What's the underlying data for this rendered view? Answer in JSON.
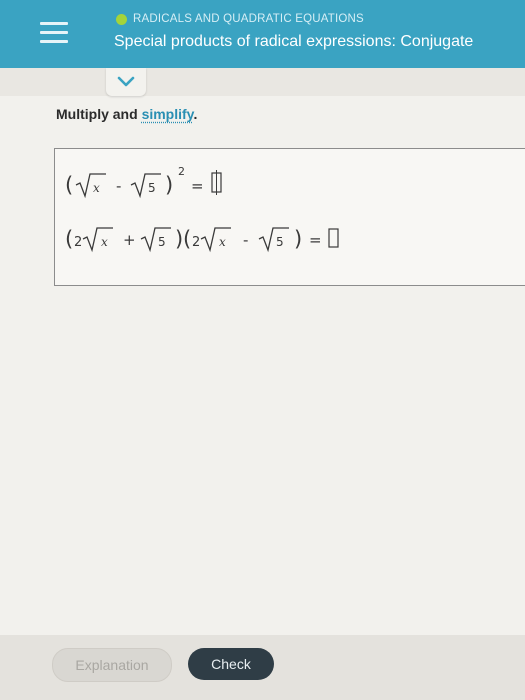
{
  "header": {
    "topic": "RADICALS AND QUADRATIC EQUATIONS",
    "title": "Special products of radical expressions: Conjugate"
  },
  "instruction": {
    "prefix": "Multiply and ",
    "link": "simplify",
    "suffix": "."
  },
  "problems": {
    "p1": {
      "open": "(",
      "rad1": "x",
      "minus": "-",
      "rad2": "5",
      "close": ")",
      "exponent": "2",
      "equals": "="
    },
    "p2": {
      "open1": "(",
      "coef1": "2",
      "rad1": "x",
      "plus": "+",
      "rad2": "5",
      "close1": ")",
      "open2": "(",
      "coef2": "2",
      "rad3": "x",
      "minus": "-",
      "rad4": "5",
      "close2": ")",
      "equals": "="
    }
  },
  "buttons": {
    "explanation": "Explanation",
    "check": "Check"
  },
  "colors": {
    "header": "#3aa3c2",
    "topic_dot": "#a4d43a",
    "check_button": "#2f3d46"
  }
}
